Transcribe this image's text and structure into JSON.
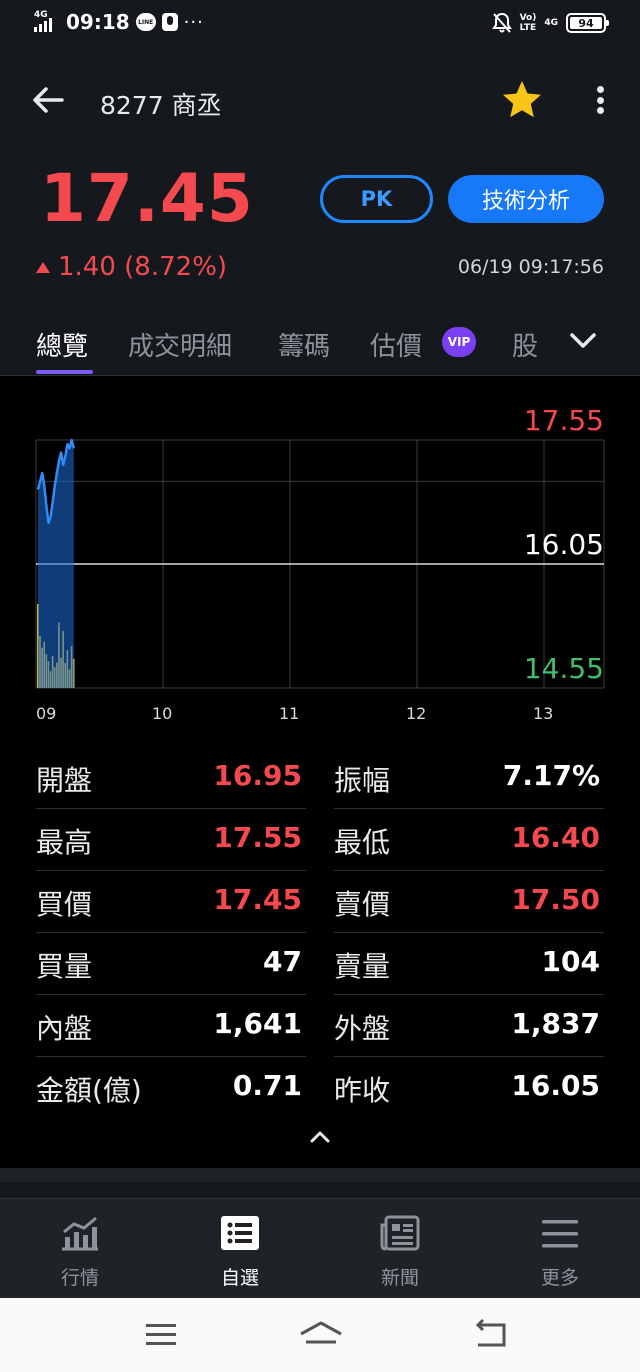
{
  "status_bar": {
    "network": "4G",
    "time": "09:18",
    "app_badge": "LINE",
    "volte_top": "Vo)",
    "volte_bottom": "LTE",
    "net_right": "4G",
    "battery": "94"
  },
  "header": {
    "title": "8277 商丞"
  },
  "quote": {
    "price": "17.45",
    "change": "1.40 (8.72%)",
    "timestamp": "06/19 09:17:56",
    "pk_label": "PK",
    "ta_label": "技術分析"
  },
  "tabs": [
    {
      "label": "總覽",
      "active": true
    },
    {
      "label": "成交明細",
      "active": false
    },
    {
      "label": "籌碼",
      "active": false
    },
    {
      "label": "估價",
      "active": false
    },
    {
      "label": "股",
      "active": false
    }
  ],
  "vip_badge": "VIP",
  "chart_data": {
    "type": "line",
    "x_ticks": [
      "09",
      "10",
      "11",
      "12",
      "13"
    ],
    "y_ticks": [
      {
        "label": "17.55",
        "value": 17.55,
        "color": "#f44a4f"
      },
      {
        "label": "16.05",
        "value": 16.05,
        "color": "#ffffff"
      },
      {
        "label": "14.55",
        "value": 14.55,
        "color": "#3fbf6f"
      }
    ],
    "ylim": [
      14.55,
      17.55
    ],
    "reference_price": 16.05,
    "series": [
      {
        "type": "area",
        "color": "#2f8cf5",
        "x_minutes": [
          0,
          1,
          2,
          3,
          4,
          5,
          6,
          7,
          8,
          9,
          10,
          11,
          12,
          13,
          14,
          15,
          16,
          17
        ],
        "values": [
          16.95,
          17.05,
          17.15,
          17.0,
          16.75,
          16.55,
          16.62,
          16.8,
          17.0,
          17.15,
          17.3,
          17.4,
          17.25,
          17.35,
          17.5,
          17.45,
          17.55,
          17.45
        ]
      },
      {
        "type": "volume",
        "color": "#e6c229",
        "x_minutes": [
          0,
          1,
          2,
          3,
          4,
          5,
          6,
          7,
          8,
          9,
          10,
          11,
          12,
          13,
          14,
          15,
          16,
          17
        ],
        "values": [
          100,
          62,
          48,
          55,
          40,
          32,
          20,
          38,
          25,
          30,
          78,
          36,
          68,
          30,
          45,
          22,
          50,
          35
        ]
      }
    ],
    "grid": true
  },
  "stats": [
    {
      "left_label": "開盤",
      "left_value": "16.95",
      "left_red": true,
      "right_label": "振幅",
      "right_value": "7.17%",
      "right_red": false
    },
    {
      "left_label": "最高",
      "left_value": "17.55",
      "left_red": true,
      "right_label": "最低",
      "right_value": "16.40",
      "right_red": true
    },
    {
      "left_label": "買價",
      "left_value": "17.45",
      "left_red": true,
      "right_label": "賣價",
      "right_value": "17.50",
      "right_red": true
    },
    {
      "left_label": "買量",
      "left_value": "47",
      "left_red": false,
      "right_label": "賣量",
      "right_value": "104",
      "right_red": false
    },
    {
      "left_label": "內盤",
      "left_value": "1,641",
      "left_red": false,
      "right_label": "外盤",
      "right_value": "1,837",
      "right_red": false
    },
    {
      "left_label": "金額(億)",
      "left_value": "0.71",
      "left_red": false,
      "right_label": "昨收",
      "right_value": "16.05",
      "right_red": false
    }
  ],
  "bottom_nav": [
    {
      "label": "行情",
      "icon": "market-chart-icon",
      "active": false
    },
    {
      "label": "自選",
      "icon": "watchlist-icon",
      "active": true
    },
    {
      "label": "新聞",
      "icon": "news-icon",
      "active": false
    },
    {
      "label": "更多",
      "icon": "menu-icon",
      "active": false
    }
  ],
  "colors": {
    "up": "#f44a4f",
    "down": "#3fbf6f",
    "accent": "#1779f7",
    "tab_indicator": "#7a5cf0",
    "volume": "#e6c229"
  }
}
